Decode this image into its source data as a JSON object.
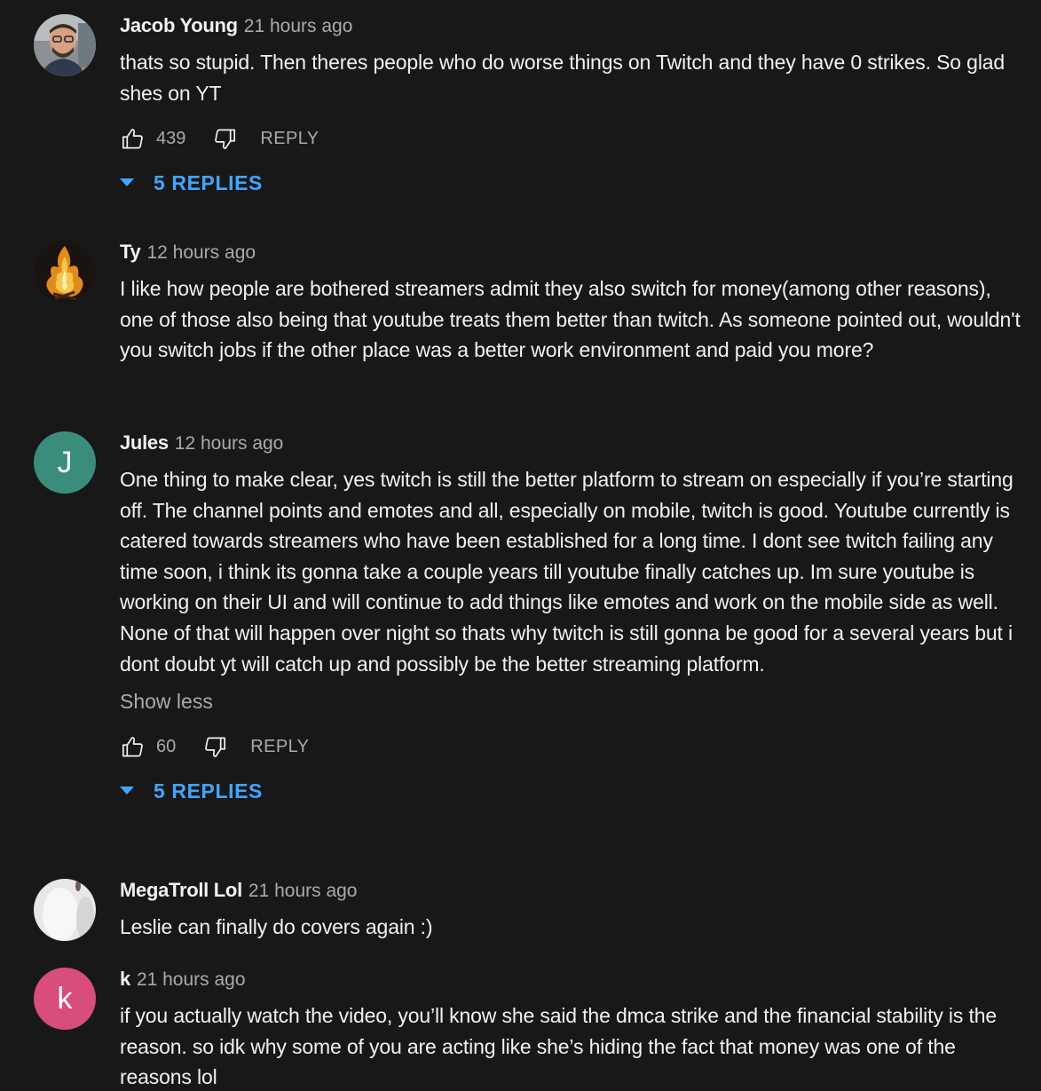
{
  "colors": {
    "background": "#181818",
    "text_primary": "#f1f1f1",
    "text_secondary": "#aaaaaa",
    "link_blue": "#3ea6ff"
  },
  "comments": [
    {
      "author": "Jacob Young",
      "time": "21 hours ago",
      "text": "thats so stupid. Then theres people who do worse things on Twitch and they have 0 strikes. So glad shes on YT",
      "likes": "439",
      "reply_label": "REPLY",
      "replies_label": "5 REPLIES",
      "avatar_icon": "photo-avatar-man"
    },
    {
      "author": "Ty",
      "time": "12 hours ago",
      "text": "I like how people are bothered streamers admit they also switch for money(among other reasons), one of those also being that youtube treats them better than twitch. As someone pointed out, wouldn't you switch jobs if the other place was a better work environment and paid you more?",
      "avatar_icon": "photo-avatar-fire"
    },
    {
      "author": "Jules",
      "time": "12 hours ago",
      "text": "One thing to make clear, yes twitch is still the better platform to stream on especially if you’re starting off. The channel points and emotes and all, especially on mobile, twitch is good. Youtube currently is catered towards streamers who have been established for a long time. I dont see twitch failing any time soon, i think its gonna take a couple years till youtube finally catches up. Im sure youtube is working on their UI and will continue to add things like emotes and work on the mobile side as well. None of that will happen over night so thats why twitch is still gonna be good for a several years but i dont doubt yt will catch up and possibly be the better streaming platform.",
      "show_less": "Show less",
      "likes": "60",
      "reply_label": "REPLY",
      "replies_label": "5 REPLIES",
      "avatar_letter": "J",
      "avatar_color": "#3b8d7b"
    },
    {
      "author": "MegaTroll Lol",
      "time": "21 hours ago",
      "text": "Leslie can finally do covers again :)",
      "avatar_icon": "photo-avatar-white"
    },
    {
      "author": "k",
      "time": "21 hours ago",
      "text": "if you actually watch the video, you’ll know she said the dmca strike and the financial stability is the reason. so idk why some of you are acting like she’s hiding the fact that money was one of the reasons lol",
      "avatar_letter": "k",
      "avatar_color": "#d94d7b"
    }
  ]
}
